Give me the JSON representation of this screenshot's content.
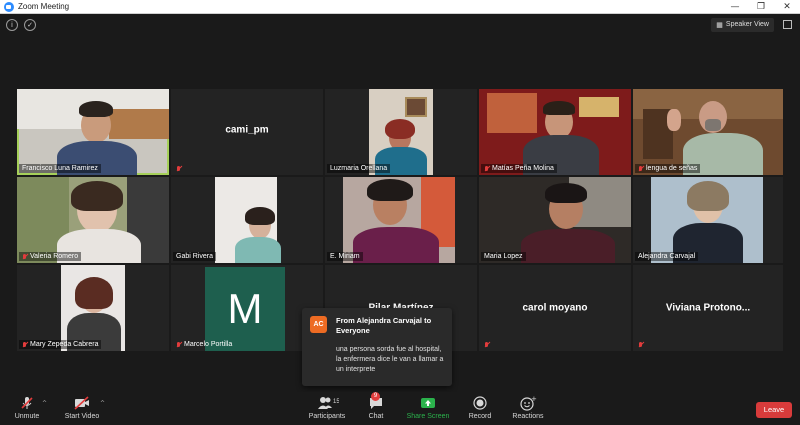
{
  "window": {
    "title": "Zoom Meeting"
  },
  "topbar": {
    "speaker_view": "Speaker View"
  },
  "participants": [
    {
      "name": "Francisco Luna Ramirez"
    },
    {
      "name": "cami_pm",
      "center": "cami_pm"
    },
    {
      "name": "Luzmaria Orellana"
    },
    {
      "name": "Matías Peña Molina"
    },
    {
      "name": "lengua de señas"
    },
    {
      "name": "Valeria Romero"
    },
    {
      "name": "Gabi Rivera"
    },
    {
      "name": "E. Miriam"
    },
    {
      "name": "Maria Lopez"
    },
    {
      "name": "Alejandra Carvajal"
    },
    {
      "name": "Mary Zepeda Cabrera"
    },
    {
      "name": "Marcelo Portilla",
      "avatar": "M"
    },
    {
      "center": "Pilar Martínez"
    },
    {
      "center": "carol moyano"
    },
    {
      "center": "Viviana  Protono..."
    }
  ],
  "chat_popup": {
    "initials": "AC",
    "from": "From Alejandra Carvajal to Everyone",
    "message": "una persona sorda fue al hospital, la enfermera dice le van a llamar a un interprete"
  },
  "toolbar": {
    "unmute": "Unmute",
    "start_video": "Start Video",
    "participants": "Participants",
    "participants_count": "15",
    "chat": "Chat",
    "chat_count": "9",
    "share_screen": "Share Screen",
    "record": "Record",
    "reactions": "Reactions",
    "leave": "Leave"
  },
  "colors": {
    "active_speaker": "#a6d05a",
    "share_green": "#2bb24c",
    "leave_red": "#d83b3b",
    "chat_badge": "#ed6b23"
  }
}
